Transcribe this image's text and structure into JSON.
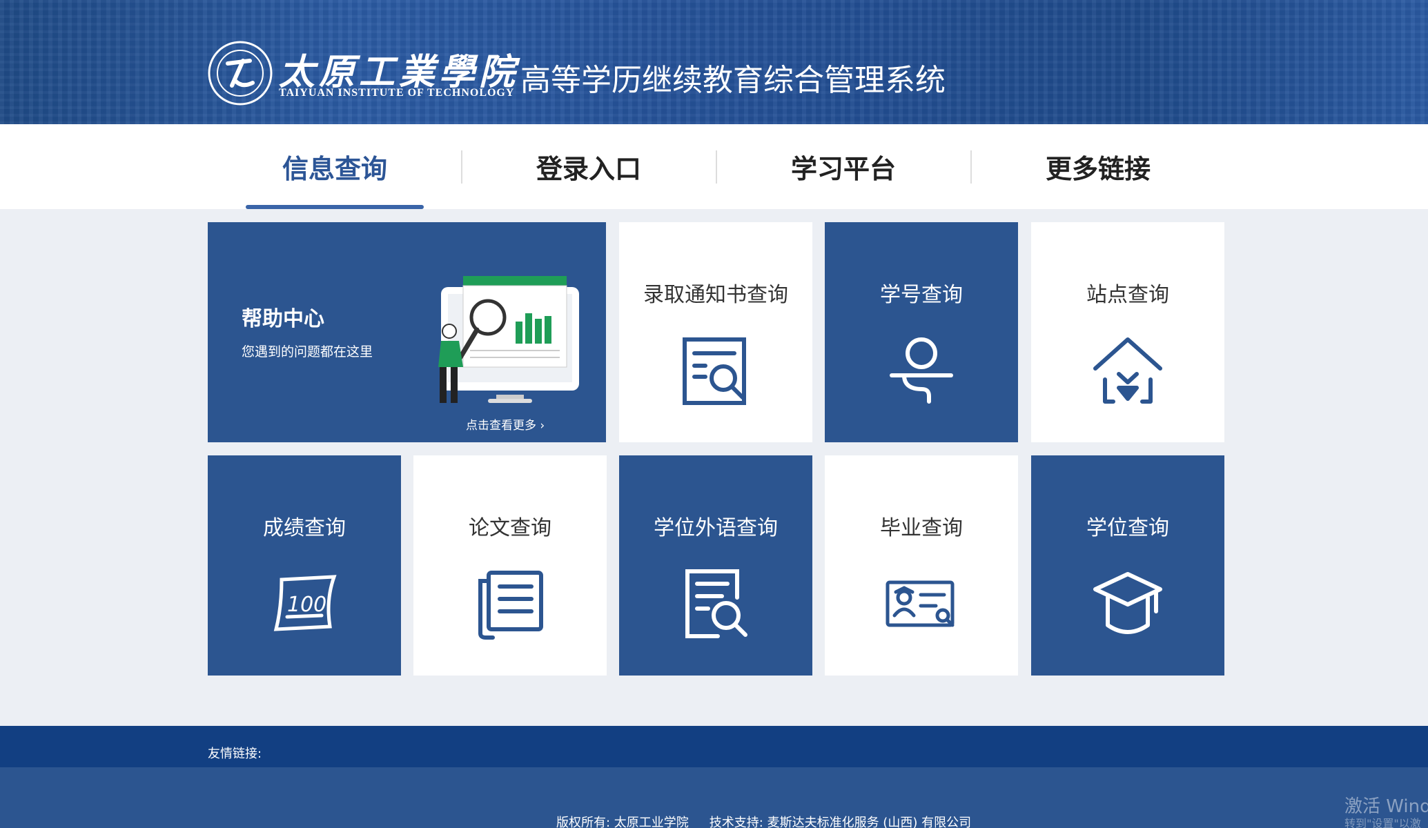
{
  "header": {
    "logo_cn": "太原工業學院",
    "logo_en": "TAIYUAN INSTITUTE OF TECHNOLOGY",
    "system_title": "高等学历继续教育综合管理系统"
  },
  "nav": {
    "items": [
      {
        "label": "信息查询",
        "active": true
      },
      {
        "label": "登录入口"
      },
      {
        "label": "学习平台"
      },
      {
        "label": "更多链接"
      }
    ]
  },
  "help": {
    "title": "帮助中心",
    "subtitle": "您遇到的问题都在这里",
    "more": "点击查看更多"
  },
  "tiles": {
    "admission": {
      "label": "录取通知书查询",
      "icon": "search-document-icon"
    },
    "student_id": {
      "label": "学号查询",
      "icon": "user-id-icon"
    },
    "station": {
      "label": "站点查询",
      "icon": "home-location-icon"
    },
    "score": {
      "label": "成绩查询",
      "icon": "score-100-icon"
    },
    "thesis": {
      "label": "论文查询",
      "icon": "document-list-icon"
    },
    "foreign_lang": {
      "label": "学位外语查询",
      "icon": "document-search-icon"
    },
    "graduation": {
      "label": "毕业查询",
      "icon": "certificate-icon"
    },
    "degree": {
      "label": "学位查询",
      "icon": "graduation-cap-icon"
    }
  },
  "footer": {
    "links_label": "友情链接:",
    "copyright": "版权所有: 太原工业学院",
    "support": "技术支持: 麦斯达夫标准化服务 (山西) 有限公司"
  },
  "watermark": {
    "line1": "激活 Windo",
    "line2": "转到\"设置\"以激"
  },
  "colors": {
    "primary_blue": "#2c5590",
    "dark_blue": "#123f82",
    "page_bg": "#eceff4",
    "chart_green": "#1f9d57"
  }
}
